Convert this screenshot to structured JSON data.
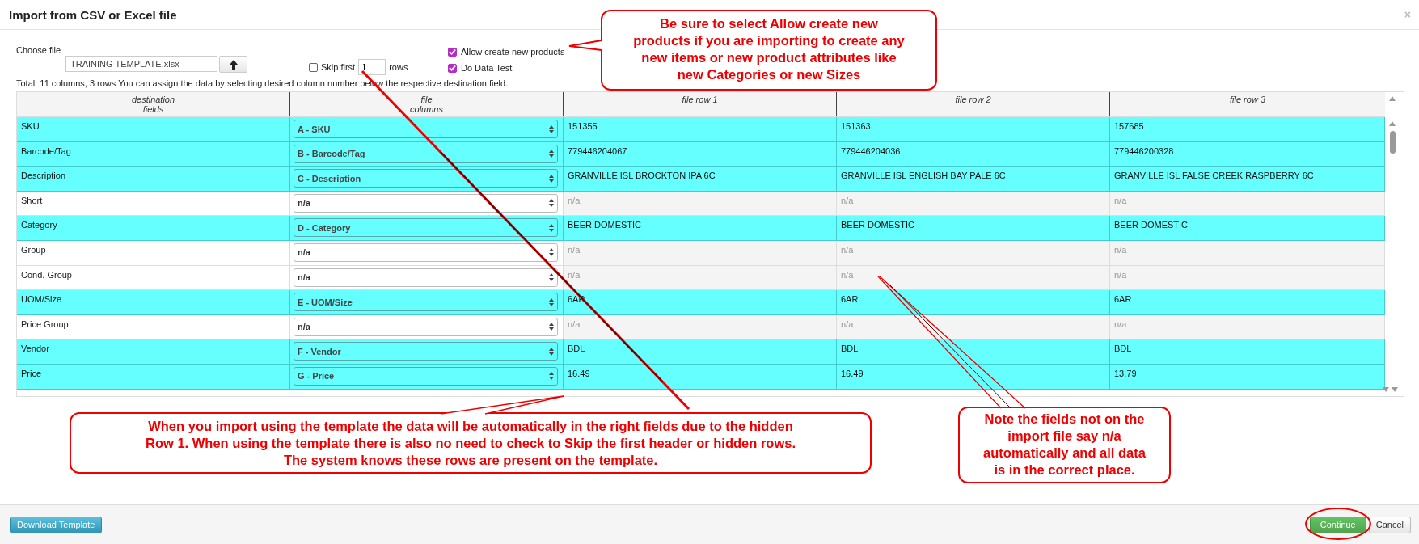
{
  "window": {
    "title": "Import from CSV or Excel file",
    "close": "×"
  },
  "file": {
    "label": "Choose file",
    "value": "TRAINING TEMPLATE.xlsx"
  },
  "skip": {
    "checked": false,
    "label_before": "Skip first",
    "value": "1",
    "label_after": "rows"
  },
  "options": [
    {
      "label": "Allow create new products",
      "checked": true
    },
    {
      "label": "Do Data Test",
      "checked": true
    }
  ],
  "summary": "Total: 11 columns, 3 rows You can assign the data by selecting desired column number below the respective destination field.",
  "table": {
    "columns": [
      [
        "destination",
        "fields"
      ],
      [
        "file",
        "columns"
      ],
      [
        "file row 1"
      ],
      [
        "file row 2"
      ],
      [
        "file row 3"
      ]
    ],
    "rows": [
      {
        "field": "SKU",
        "mapping": "A - SKU",
        "mapped": true,
        "values": [
          "151355",
          "151363",
          "157685"
        ]
      },
      {
        "field": "Barcode/Tag",
        "mapping": "B - Barcode/Tag",
        "mapped": true,
        "values": [
          "779446204067",
          "779446204036",
          "779446200328"
        ]
      },
      {
        "field": "Description",
        "mapping": "C - Description",
        "mapped": true,
        "values": [
          "GRANVILLE ISL BROCKTON IPA 6C",
          "GRANVILLE ISL ENGLISH BAY PALE 6C",
          "GRANVILLE ISL FALSE CREEK RASPBERRY 6C"
        ]
      },
      {
        "field": "Short",
        "mapping": "n/a",
        "mapped": false,
        "values": [
          "n/a",
          "n/a",
          "n/a"
        ]
      },
      {
        "field": "Category",
        "mapping": "D - Category",
        "mapped": true,
        "values": [
          "BEER DOMESTIC",
          "BEER DOMESTIC",
          "BEER DOMESTIC"
        ]
      },
      {
        "field": "Group",
        "mapping": "n/a",
        "mapped": false,
        "values": [
          "n/a",
          "n/a",
          "n/a"
        ]
      },
      {
        "field": "Cond. Group",
        "mapping": "n/a",
        "mapped": false,
        "values": [
          "n/a",
          "n/a",
          "n/a"
        ]
      },
      {
        "field": "UOM/Size",
        "mapping": "E - UOM/Size",
        "mapped": true,
        "values": [
          "6AR",
          "6AR",
          "6AR"
        ]
      },
      {
        "field": "Price Group",
        "mapping": "n/a",
        "mapped": false,
        "values": [
          "n/a",
          "n/a",
          "n/a"
        ]
      },
      {
        "field": "Vendor",
        "mapping": "F - Vendor",
        "mapped": true,
        "values": [
          "BDL",
          "BDL",
          "BDL"
        ]
      },
      {
        "field": "Price",
        "mapping": "G - Price",
        "mapped": true,
        "values": [
          "16.49",
          "16.49",
          "13.79"
        ]
      }
    ]
  },
  "annotations": [
    {
      "lines": [
        "Be sure to select Allow create new",
        "products if you are importing to create any",
        "new items or new product attributes like",
        "new Categories or new Sizes"
      ]
    },
    {
      "lines": [
        "When you import using the template the data will be automatically in the right fields due to the hidden",
        "Row 1. When using the template there is also no need to check to Skip the first header or hidden rows.",
        "The system knows these rows are present on the template."
      ]
    },
    {
      "lines": [
        "Note the fields not on the",
        "import file say n/a",
        "automatically and all data",
        "is in the correct place."
      ]
    }
  ],
  "footer": {
    "left_button": "Download Template",
    "buttons": [
      {
        "label": "Continue",
        "primary": true
      },
      {
        "label": "Cancel",
        "primary": false
      }
    ]
  }
}
